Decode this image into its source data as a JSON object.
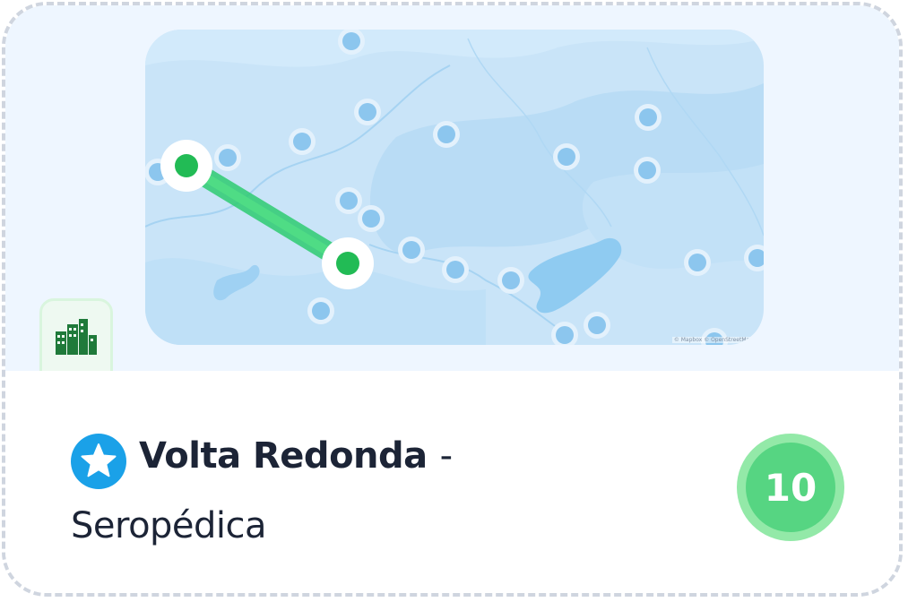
{
  "route": {
    "origin": "Volta Redonda",
    "separator": "-",
    "destination": "Seropédica"
  },
  "score": "10",
  "map": {
    "attribution": "© Mapbox © OpenStreetMap"
  },
  "colors": {
    "route_line": "#2ecc71",
    "route_marker": "#22bb55",
    "score_fill": "#56d582",
    "score_ring": "#93e9a8",
    "favorite_badge": "#1aa1e8",
    "category_icon": "#1f7a3a"
  },
  "icons": {
    "favorite": "star-icon",
    "category": "city-buildings-icon"
  }
}
